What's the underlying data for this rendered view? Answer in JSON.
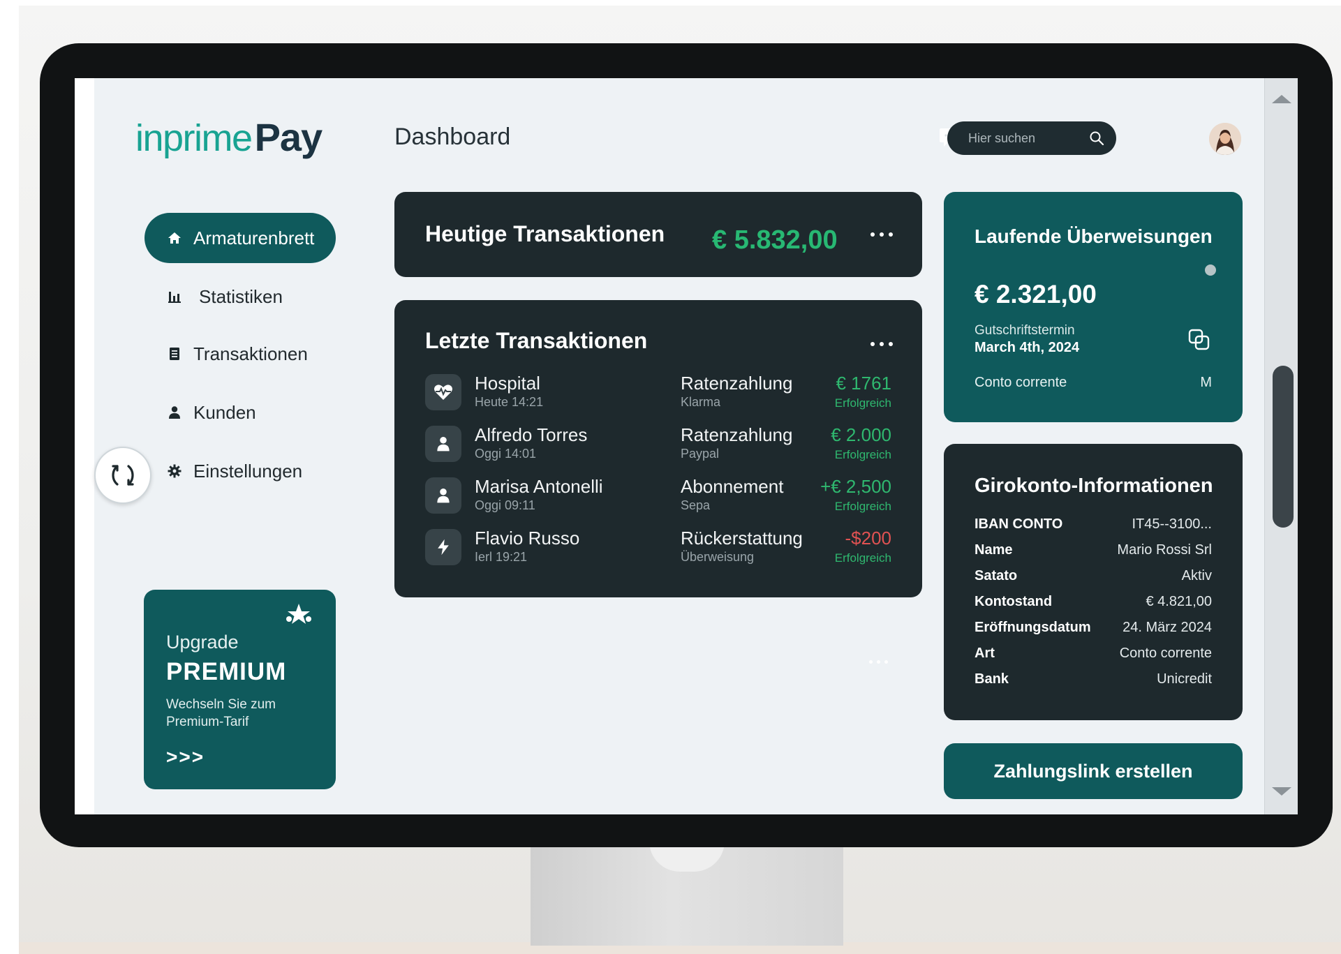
{
  "brand": {
    "part1": "inprime",
    "part2": "Pay",
    "color_teal": "#18a392",
    "color_navy": "#1c3342"
  },
  "header": {
    "title": "Dashboard",
    "search_placeholder": "Hier suchen"
  },
  "sidebar": {
    "items": [
      {
        "label": "Armaturenbrett",
        "icon": "home-icon",
        "active": true
      },
      {
        "label": "Statistiken",
        "icon": "bar-chart-icon",
        "active": false
      },
      {
        "label": "Transaktionen",
        "icon": "document-icon",
        "active": false
      },
      {
        "label": "Kunden",
        "icon": "user-icon",
        "active": false
      },
      {
        "label": "Einstellungen",
        "icon": "gear-icon",
        "active": false
      }
    ]
  },
  "premium": {
    "upgrade": "Upgrade",
    "plan": "PREMIUM",
    "description": "Wechseln Sie zum Premium-Tarif",
    "arrows": ">>>"
  },
  "today": {
    "title": "Heutige Transaktionen",
    "amount": "€ 5.832,00"
  },
  "recent": {
    "title": "Letzte Transaktionen",
    "rows": [
      {
        "icon": "heart-pulse-icon",
        "name": "Hospital",
        "time": "Heute 14:21",
        "type": "Ratenzahlung",
        "method": "Klarma",
        "amount": "€ 1761",
        "amount_kind": "pos",
        "status": "Erfolgreich"
      },
      {
        "icon": "user-icon",
        "name": "Alfredo Torres",
        "time": "Oggi 14:01",
        "type": "Ratenzahlung",
        "method": "Paypal",
        "amount": "€ 2.000",
        "amount_kind": "pos",
        "status": "Erfolgreich"
      },
      {
        "icon": "user-icon",
        "name": "Marisa Antonelli",
        "time": "Oggi 09:11",
        "type": "Abonnement",
        "method": "Sepa",
        "amount": "+€ 2,500",
        "amount_kind": "pos",
        "status": "Erfolgreich"
      },
      {
        "icon": "lightning-icon",
        "name": "Flavio Russo",
        "time": "Ierl 19:21",
        "type": "Rückerstattung",
        "method": "Überweisung",
        "amount": "-$200",
        "amount_kind": "neg",
        "status": "Erfolgreich"
      }
    ]
  },
  "running": {
    "title": "Laufende Überweisungen",
    "amount": "€ 2.321,00",
    "date_label": "Gutschriftstermin",
    "date": "March 4th, 2024",
    "account": "Conto corrente",
    "account_suffix": "M"
  },
  "giro": {
    "title": "Girokonto-Informationen",
    "rows": [
      {
        "key": "IBAN CONTO",
        "value": "IT45--3100..."
      },
      {
        "key": "Name",
        "value": "Mario Rossi Srl"
      },
      {
        "key": "Satato",
        "value": "Aktiv"
      },
      {
        "key": "Kontostand",
        "value": "€ 4.821,00"
      },
      {
        "key": "Eröffnungsdatum",
        "value": "24. März 2024"
      },
      {
        "key": "Art",
        "value": "Conto corrente"
      },
      {
        "key": "Bank",
        "value": "Unicredit"
      }
    ]
  },
  "actions": {
    "payment_link": "Zahlungslink erstellen"
  },
  "colors": {
    "accent": "#0f5a5c",
    "dark_card": "#1e292d",
    "positive": "#2fb86f",
    "negative": "#e05252"
  }
}
